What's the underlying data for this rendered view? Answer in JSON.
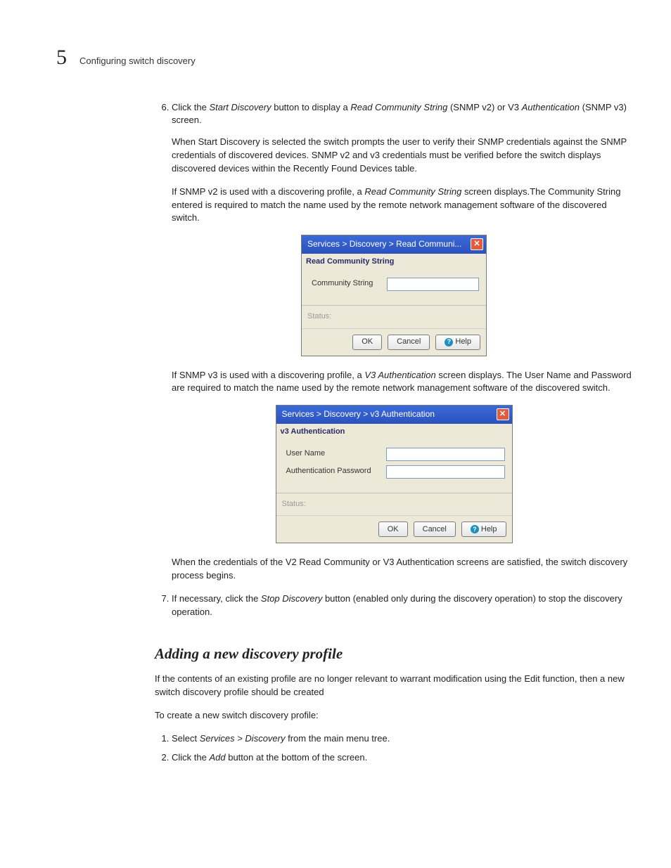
{
  "header": {
    "chapter_number": "5",
    "running_head": "Configuring switch discovery"
  },
  "step6": {
    "num": "6",
    "p1_a": "Click the ",
    "p1_b": "Start Discovery",
    "p1_c": " button to display a ",
    "p1_d": "Read Community String",
    "p1_e": " (SNMP v2) or V3 ",
    "p1_f": "Authentication",
    "p1_g": " (SNMP v3) screen.",
    "p2": "When Start Discovery is selected the switch prompts the user to verify their SNMP credentials against the SNMP credentials of discovered devices. SNMP v2 and v3 credentials must be verified before the switch displays discovered devices within the Recently Found Devices table.",
    "p3_a": "If SNMP v2 is used with a discovering profile, a ",
    "p3_b": "Read Community String",
    "p3_c": " screen displays.The Community String entered is required to match the name used by the remote network management software of the discovered switch.",
    "p4_a": "If SNMP v3 is used with a discovering profile, a ",
    "p4_b": "V3 Authentication",
    "p4_c": " screen displays. The User Name and Password are required to match the name used by the remote network management software of the discovered switch.",
    "p5": "When the credentials of the V2 Read Community or V3 Authentication screens are satisfied, the switch discovery process begins."
  },
  "step7": {
    "num": "7",
    "a": "If necessary, click the ",
    "b": "Stop Discovery",
    "c": " button (enabled only during the discovery operation) to stop the discovery operation."
  },
  "dialog1": {
    "title": "Services > Discovery > Read Communi...",
    "panel": "Read Community String",
    "field": "Community String",
    "status": "Status:",
    "ok": "OK",
    "cancel": "Cancel",
    "help": "Help"
  },
  "dialog2": {
    "title": "Services > Discovery > v3 Authentication",
    "panel": "v3 Authentication",
    "field1": "User Name",
    "field2": "Authentication Password",
    "status": "Status:",
    "ok": "OK",
    "cancel": "Cancel",
    "help": "Help"
  },
  "section2": {
    "heading": "Adding a new discovery profile",
    "p1": "If the contents of an existing profile are no longer relevant to warrant modification using the Edit function, then a new switch discovery profile should be created",
    "p2": "To create a new switch discovery profile:",
    "li1_a": "Select ",
    "li1_b": "Services > Discovery",
    "li1_c": " from the main menu tree.",
    "li2_a": "Click the ",
    "li2_b": "Add",
    "li2_c": " button at the bottom of the screen."
  }
}
